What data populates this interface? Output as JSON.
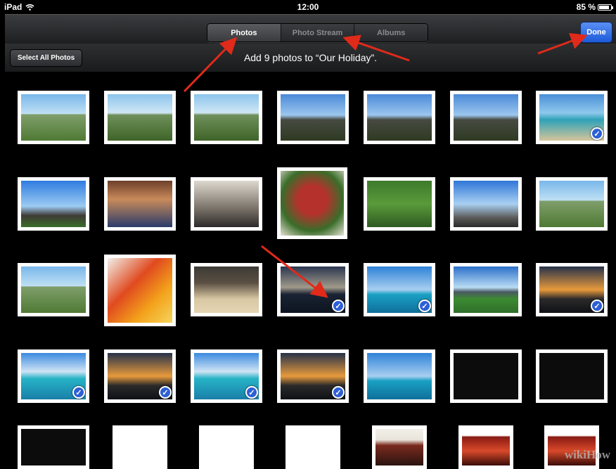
{
  "status_bar": {
    "device": "iPad",
    "time": "12:00",
    "battery": "85 %",
    "battery_level": 0.85
  },
  "nav": {
    "tabs": [
      "Photos",
      "Photo Stream",
      "Albums"
    ],
    "active_tab": 0,
    "done_label": "Done"
  },
  "toolbar": {
    "select_all_label": "Select All Photos",
    "title": "Add 9 photos to “Our Holiday”."
  },
  "photos": [
    {
      "row": 0,
      "col": 0,
      "style": "land1",
      "selected": false
    },
    {
      "row": 0,
      "col": 1,
      "style": "coast",
      "selected": false
    },
    {
      "row": 0,
      "col": 2,
      "style": "coast",
      "selected": false
    },
    {
      "row": 0,
      "col": 3,
      "style": "castle",
      "selected": false
    },
    {
      "row": 0,
      "col": 4,
      "style": "castle",
      "selected": false
    },
    {
      "row": 0,
      "col": 5,
      "style": "castle",
      "selected": false
    },
    {
      "row": 0,
      "col": 6,
      "style": "beach",
      "selected": true
    },
    {
      "row": 1,
      "col": 0,
      "style": "ruin",
      "selected": false
    },
    {
      "row": 1,
      "col": 1,
      "style": "people",
      "selected": false
    },
    {
      "row": 1,
      "col": 2,
      "style": "food",
      "selected": false
    },
    {
      "row": 1,
      "col": 3,
      "style": "steak",
      "selected": false
    },
    {
      "row": 1,
      "col": 4,
      "style": "cows",
      "selected": false
    },
    {
      "row": 1,
      "col": 5,
      "style": "bridge",
      "selected": false
    },
    {
      "row": 1,
      "col": 6,
      "style": "land1",
      "selected": false
    },
    {
      "row": 2,
      "col": 0,
      "style": "land1",
      "selected": false
    },
    {
      "row": 2,
      "col": 1,
      "style": "cocktail",
      "selected": false
    },
    {
      "row": 2,
      "col": 2,
      "style": "rocks",
      "selected": false
    },
    {
      "row": 2,
      "col": 3,
      "style": "sunset",
      "selected": true
    },
    {
      "row": 2,
      "col": 4,
      "style": "sea",
      "selected": true
    },
    {
      "row": 2,
      "col": 5,
      "style": "stadium",
      "selected": false
    },
    {
      "row": 2,
      "col": 6,
      "style": "dusk",
      "selected": true
    },
    {
      "row": 3,
      "col": 0,
      "style": "turq",
      "selected": true
    },
    {
      "row": 3,
      "col": 1,
      "style": "dusk",
      "selected": true
    },
    {
      "row": 3,
      "col": 2,
      "style": "turq",
      "selected": true
    },
    {
      "row": 3,
      "col": 3,
      "style": "dusk",
      "selected": true
    },
    {
      "row": 3,
      "col": 4,
      "style": "sea",
      "selected": false
    },
    {
      "row": 3,
      "col": 5,
      "style": "dark",
      "selected": false
    },
    {
      "row": 3,
      "col": 6,
      "style": "dark",
      "selected": false
    },
    {
      "row": 4,
      "col": 0,
      "style": "dark",
      "selected": false
    },
    {
      "row": 4,
      "col": 1,
      "style": "doc",
      "selected": false
    },
    {
      "row": 4,
      "col": 2,
      "style": "doc",
      "selected": false
    },
    {
      "row": 4,
      "col": 3,
      "style": "doc",
      "selected": false
    },
    {
      "row": 4,
      "col": 4,
      "style": "symph",
      "selected": false
    },
    {
      "row": 4,
      "col": 5,
      "style": "theatre",
      "selected": false
    },
    {
      "row": 4,
      "col": 6,
      "style": "theatre",
      "selected": false
    }
  ],
  "watermark": "wikiHow",
  "colors": {
    "accent_blue": "#2d5fd6",
    "arrow_red": "#e02a1a"
  }
}
